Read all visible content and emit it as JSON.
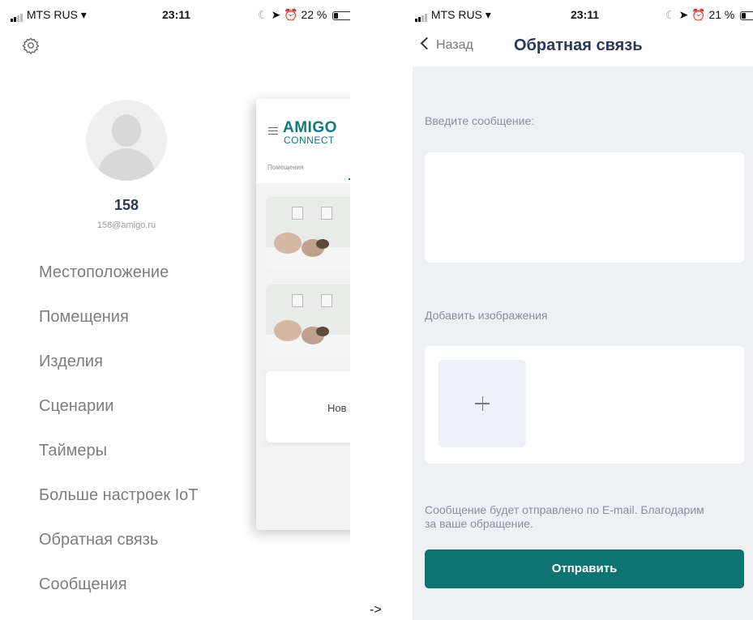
{
  "left_screen": {
    "status": {
      "carrier": "MTS RUS",
      "time": "23:11",
      "battery": "22 %"
    },
    "user": {
      "name": "158",
      "email": "158@amigo.ru"
    },
    "menu": [
      "Местоположение",
      "Помещения",
      "Изделия",
      "Сценарии",
      "Таймеры",
      "Больше настроек IoT",
      "Обратная связь",
      "Сообщения"
    ],
    "preview": {
      "brand_line1": "AMIGO",
      "brand_line2": "CONNECT",
      "tab_label": "Помещения",
      "new_card_label": "Нов"
    },
    "icons": [
      "gear-icon",
      "avatar-icon",
      "hamburger-icon"
    ]
  },
  "arrow": "->",
  "right_screen": {
    "status": {
      "carrier": "MTS RUS",
      "time": "23:11",
      "battery": "21 %"
    },
    "back_label": "Назад",
    "title": "Обратная связь",
    "message_label": "Введите сообщение:",
    "images_label": "Добавить изображения",
    "note": "Сообщение будет отправлено по E-mail. Благодарим за ваше обращение.",
    "send_label": "Отправить",
    "colors": {
      "accent": "#0e7371",
      "title": "#2a3a55",
      "background": "#eef0f4"
    }
  }
}
